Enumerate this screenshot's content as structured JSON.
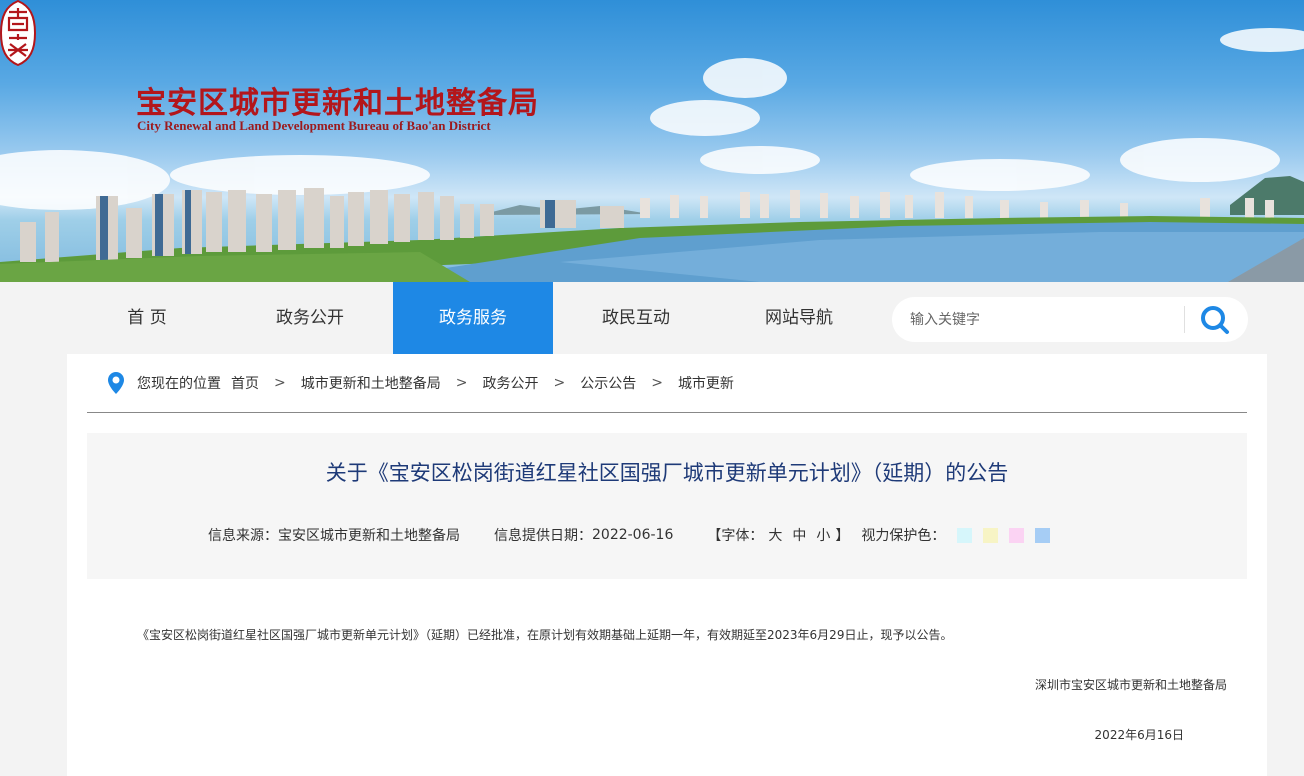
{
  "header": {
    "title": "宝安区城市更新和土地整备局",
    "subtitle": "City Renewal and Land Development Bureau  of Bao'an District",
    "seal_text": "宝安"
  },
  "nav": {
    "items": [
      {
        "label": "首 页"
      },
      {
        "label": "政务公开"
      },
      {
        "label": "政务服务"
      },
      {
        "label": "政民互动"
      },
      {
        "label": "网站导航"
      }
    ],
    "active_index": 2
  },
  "search": {
    "placeholder": "输入关键字",
    "icon": "search-icon"
  },
  "breadcrumb": {
    "prefix": "您现在的位置",
    "items": [
      "首页",
      "城市更新和土地整备局",
      "政务公开",
      "公示公告",
      "城市更新"
    ],
    "separator": ">"
  },
  "article": {
    "title": "关于《宝安区松岗街道红星社区国强厂城市更新单元计划》（延期）的公告",
    "source_label": "信息来源：",
    "source": "宝安区城市更新和土地整备局",
    "date_label": "信息提供日期：",
    "date": "2022-06-16",
    "font_open": "【字体：",
    "font_large": "大",
    "font_medium": "中",
    "font_small": "小",
    "font_close": "】",
    "eye_care_label": "视力保护色：",
    "body": "《宝安区松岗街道红星社区国强厂城市更新单元计划》（延期）已经批准，在原计划有效期基础上延期一年，有效期延至2023年6月29日止，现予以公告。",
    "signature": "深圳市宝安区城市更新和土地整备局",
    "sign_date": "2022年6月16日"
  },
  "colors": {
    "brand_red": "#b3161b",
    "nav_active": "#1e88e5",
    "title_blue": "#1e3a78",
    "eye_care_swatches": [
      "#d6f6fb",
      "#f7f4c5",
      "#fbd3f3",
      "#a6cdf5"
    ]
  }
}
